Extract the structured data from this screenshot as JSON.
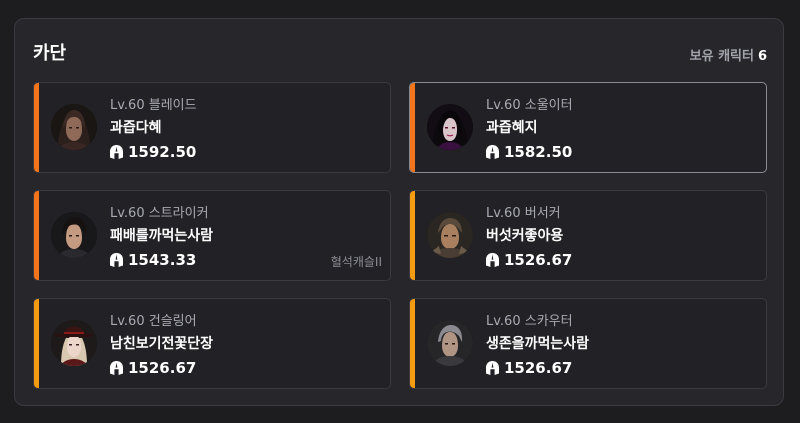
{
  "panel": {
    "title": "카단",
    "count_label": "보유 캐릭터",
    "count_value": "6"
  },
  "characters": [
    {
      "level": "Lv.60 블레이드",
      "name": "과즙다혜",
      "item_level": "1592.50",
      "tag": "",
      "accent": "#f2741b",
      "selected": false
    },
    {
      "level": "Lv.60 소울이터",
      "name": "과즙혜지",
      "item_level": "1582.50",
      "tag": "",
      "accent": "#f2741b",
      "selected": true
    },
    {
      "level": "Lv.60 스트라이커",
      "name": "패배를까먹는사람",
      "item_level": "1543.33",
      "tag": "혈석캐슬II",
      "accent": "#f2741b",
      "selected": false
    },
    {
      "level": "Lv.60 버서커",
      "name": "버섯커좋아용",
      "item_level": "1526.67",
      "tag": "",
      "accent": "#f59b12",
      "selected": false
    },
    {
      "level": "Lv.60 건슬링어",
      "name": "남친보기전꽃단장",
      "item_level": "1526.67",
      "tag": "",
      "accent": "#f59b12",
      "selected": false
    },
    {
      "level": "Lv.60 스카우터",
      "name": "생존을까먹는사람",
      "item_level": "1526.67",
      "tag": "",
      "accent": "#f59b12",
      "selected": false
    }
  ],
  "icons": {
    "item_level": "helmet-icon"
  }
}
